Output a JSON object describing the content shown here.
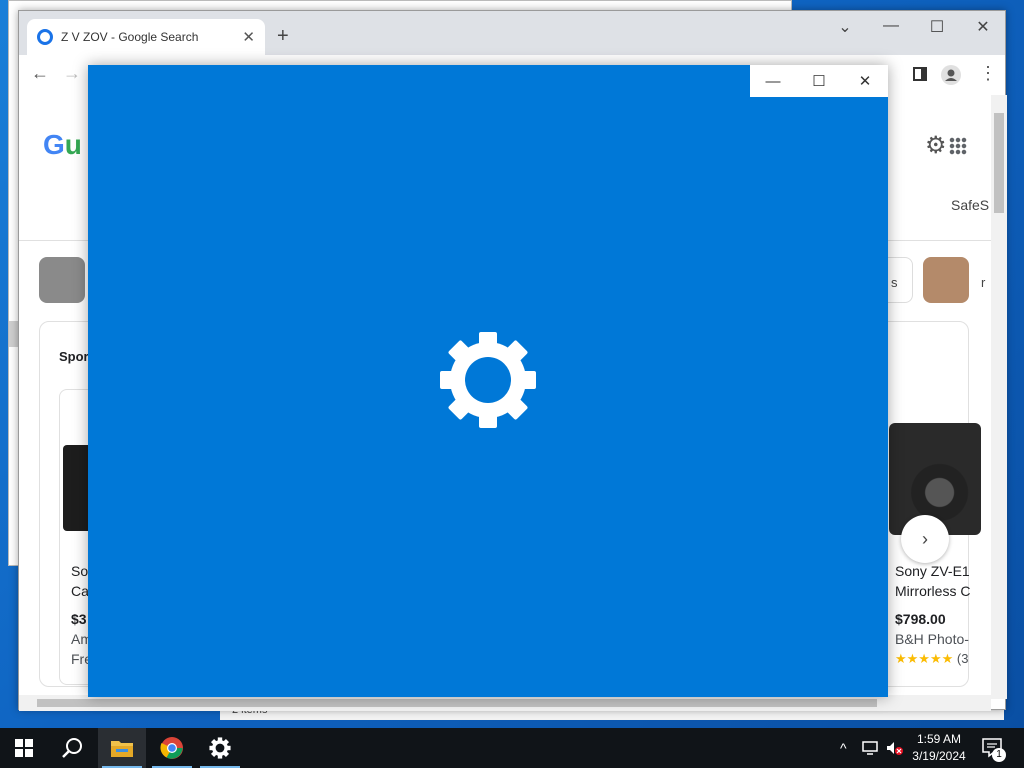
{
  "explorer": {
    "status_text": "2 items"
  },
  "browser": {
    "tab": {
      "title": "Z V ZOV - Google Search",
      "close_glyph": "✕"
    },
    "new_tab_glyph": "+",
    "window_controls": {
      "dropdown": "⌄",
      "minimize": "—",
      "maximize": "☐",
      "close": "✕"
    },
    "toolbar": {
      "back": "←",
      "forward": "→",
      "menu": "⋮"
    }
  },
  "google": {
    "logo_letters": [
      "G",
      "u"
    ],
    "safesearch_label": "SafeS",
    "chips": [
      {
        "text": "s"
      },
      {
        "text": "r"
      }
    ],
    "sponsored_label": "Spor",
    "products": [
      {
        "name_line1": "So",
        "name_line2": "Ca",
        "price": "$3",
        "seller": "Am",
        "shipping": "Fre"
      },
      {
        "name_line1": "Sony ZV-E1",
        "name_line2": "Mirrorless C",
        "price": "$798.00",
        "seller": "B&H Photo-",
        "rating_stars": "★★★★★",
        "rating_count": "(3"
      }
    ],
    "next_glyph": "›"
  },
  "splash": {
    "controls": {
      "minimize": "—",
      "maximize": "☐",
      "close": "✕"
    },
    "icon": "gear-icon",
    "color": "#0078d7"
  },
  "taskbar": {
    "clock_time": "1:59 AM",
    "clock_date": "3/19/2024",
    "notification_count": "1",
    "tray_overflow": "^"
  }
}
